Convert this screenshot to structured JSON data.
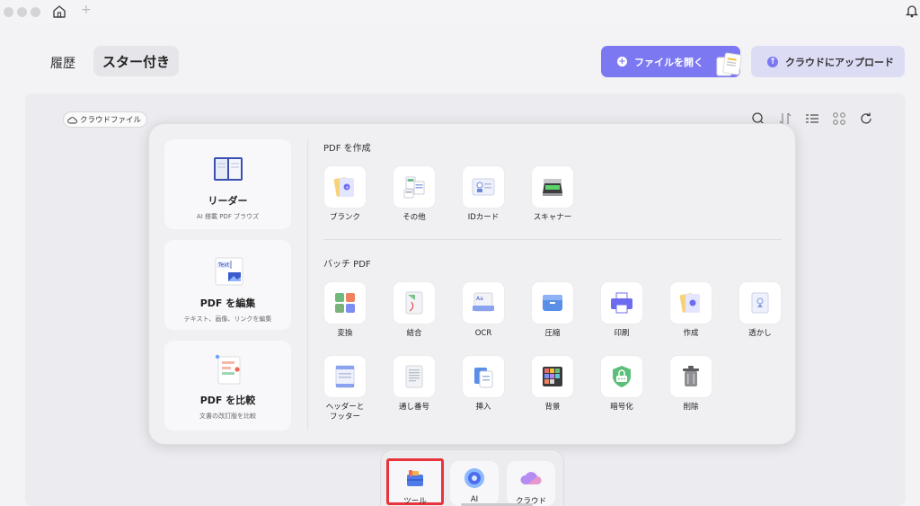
{
  "header": {
    "tab_history": "履歴",
    "tab_starred": "スター付き",
    "open_file_label": "ファイルを開く",
    "upload_label": "クラウドにアップロード"
  },
  "toolbar": {
    "cloud_chip": "クラウドファイル",
    "icons": [
      "search-icon",
      "sort-icon",
      "list-view-icon",
      "grid-view-icon",
      "refresh-icon"
    ]
  },
  "panel": {
    "cards": [
      {
        "title": "リーダー",
        "sub": "AI 搭載 PDF ブラウズ"
      },
      {
        "title": "PDF を編集",
        "sub": "テキスト、画像、リンクを編集"
      },
      {
        "title": "PDF を比較",
        "sub": "文書の改訂版を比較"
      }
    ],
    "create_section": "PDF を作成",
    "create_tools": [
      "ブランク",
      "その他",
      "IDカード",
      "スキャナー"
    ],
    "batch_section": "バッチ PDF",
    "batch_tools_row1": [
      "変換",
      "結合",
      "OCR",
      "圧縮",
      "印刷",
      "作成",
      "透かし"
    ],
    "batch_tools_row2": [
      "ヘッダーと\nフッター",
      "通し番号",
      "挿入",
      "背景",
      "暗号化",
      "削除"
    ]
  },
  "dock": {
    "items": [
      "ツール",
      "AI",
      "クラウド"
    ],
    "active": "ツール"
  },
  "colors": {
    "accent": "#7b78f2",
    "highlight": "#e8333b"
  }
}
